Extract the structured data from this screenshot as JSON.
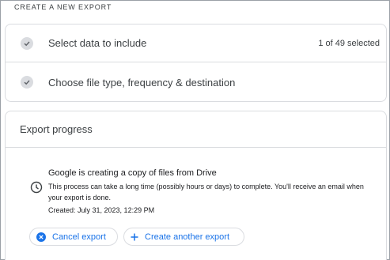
{
  "header": {
    "label": "CREATE A NEW EXPORT"
  },
  "steps": [
    {
      "label": "Select data to include",
      "count": "1 of 49 selected",
      "icon": "checkmark-icon"
    },
    {
      "label": "Choose file type, frequency & destination",
      "icon": "checkmark-icon"
    }
  ],
  "progress": {
    "title": "Export progress",
    "message_title": "Google is creating a copy of files from Drive",
    "message_body": "This process can take a long time (possibly hours or days) to complete. You'll receive an email when your export is done.",
    "created": "Created: July 31, 2023, 12:29 PM",
    "icon": "clock-icon"
  },
  "buttons": {
    "cancel": {
      "label": "Cancel export",
      "icon": "cancel-icon"
    },
    "create": {
      "label": "Create another export",
      "icon": "plus-icon"
    }
  },
  "colors": {
    "accent": "#1a73e8",
    "border": "#dadce0",
    "text": "#3c4043",
    "check_bg": "#dadce0"
  }
}
